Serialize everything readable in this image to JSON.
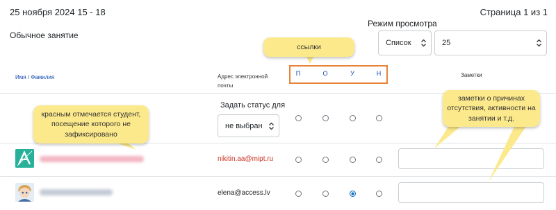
{
  "header": {
    "date": "25 ноября 2024 15 - 18",
    "page_count": "Страница 1 из 1",
    "session_type": "Обычное занятие",
    "view_mode_label": "Режим просмотра",
    "view_select": "Список",
    "count_select": "25"
  },
  "columns": {
    "name_first": "Имя",
    "name_sep": " / ",
    "name_last": "Фамилия",
    "email": "Адрес электронной почты",
    "statuses": [
      "П",
      "О",
      "У",
      "Н"
    ],
    "notes": "Заметки"
  },
  "bulk": {
    "set_status_label": "Задать статус для",
    "set_status_value": "не выбран"
  },
  "rows": [
    {
      "email": "nikitin.aa@mipt.ru",
      "email_color": "#ca3120",
      "selected_status": null,
      "not_registered": true
    },
    {
      "email": "elena@access.lv",
      "email_color": "#1d2125",
      "selected_status": "У",
      "not_registered": false
    }
  ],
  "callouts": {
    "links": "ссылки",
    "red_student": "красным отмечается студент, посещение которого не зафиксировано",
    "notes": "заметки о причинах отсутствия, активности на занятии и т.д."
  },
  "colors": {
    "callout_bg": "#fce98b",
    "status_box_border": "#e8833a",
    "link": "#0f47ad",
    "absent_red": "#ca3120"
  }
}
